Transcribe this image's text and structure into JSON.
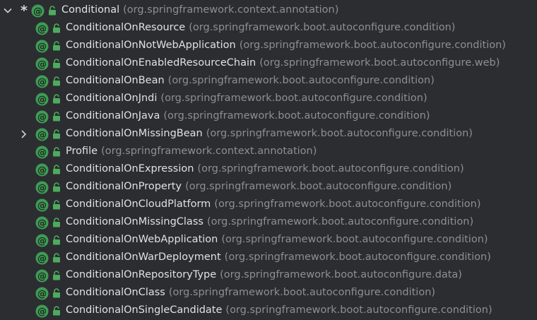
{
  "colors": {
    "background": "#2b2d30",
    "class_name": "#dfe1e5",
    "package_name": "#8c8f94",
    "annotation_icon": "#3f9b55",
    "lock_icon": "#4eab5e"
  },
  "icons": {
    "expand": "chevron-down-icon",
    "collapse": "chevron-right-icon",
    "annotation": "annotation-icon",
    "visibility": "lock-icon"
  },
  "root": {
    "marker": "*",
    "name": "Conditional",
    "package": "(org.springframework.context.annotation)"
  },
  "children": [
    {
      "name": "ConditionalOnResource",
      "package": "(org.springframework.boot.autoconfigure.condition)",
      "expandable": false
    },
    {
      "name": "ConditionalOnNotWebApplication",
      "package": "(org.springframework.boot.autoconfigure.condition)",
      "expandable": false
    },
    {
      "name": "ConditionalOnEnabledResourceChain",
      "package": "(org.springframework.boot.autoconfigure.web)",
      "expandable": false
    },
    {
      "name": "ConditionalOnBean",
      "package": "(org.springframework.boot.autoconfigure.condition)",
      "expandable": false
    },
    {
      "name": "ConditionalOnJndi",
      "package": "(org.springframework.boot.autoconfigure.condition)",
      "expandable": false
    },
    {
      "name": "ConditionalOnJava",
      "package": "(org.springframework.boot.autoconfigure.condition)",
      "expandable": false
    },
    {
      "name": "ConditionalOnMissingBean",
      "package": "(org.springframework.boot.autoconfigure.condition)",
      "expandable": true
    },
    {
      "name": "Profile",
      "package": "(org.springframework.context.annotation)",
      "expandable": false
    },
    {
      "name": "ConditionalOnExpression",
      "package": "(org.springframework.boot.autoconfigure.condition)",
      "expandable": false
    },
    {
      "name": "ConditionalOnProperty",
      "package": "(org.springframework.boot.autoconfigure.condition)",
      "expandable": false
    },
    {
      "name": "ConditionalOnCloudPlatform",
      "package": "(org.springframework.boot.autoconfigure.condition)",
      "expandable": false
    },
    {
      "name": "ConditionalOnMissingClass",
      "package": "(org.springframework.boot.autoconfigure.condition)",
      "expandable": false
    },
    {
      "name": "ConditionalOnWebApplication",
      "package": "(org.springframework.boot.autoconfigure.condition)",
      "expandable": false
    },
    {
      "name": "ConditionalOnWarDeployment",
      "package": "(org.springframework.boot.autoconfigure.condition)",
      "expandable": false
    },
    {
      "name": "ConditionalOnRepositoryType",
      "package": "(org.springframework.boot.autoconfigure.data)",
      "expandable": false
    },
    {
      "name": "ConditionalOnClass",
      "package": "(org.springframework.boot.autoconfigure.condition)",
      "expandable": false
    },
    {
      "name": "ConditionalOnSingleCandidate",
      "package": "(org.springframework.boot.autoconfigure.condition)",
      "expandable": false
    }
  ]
}
